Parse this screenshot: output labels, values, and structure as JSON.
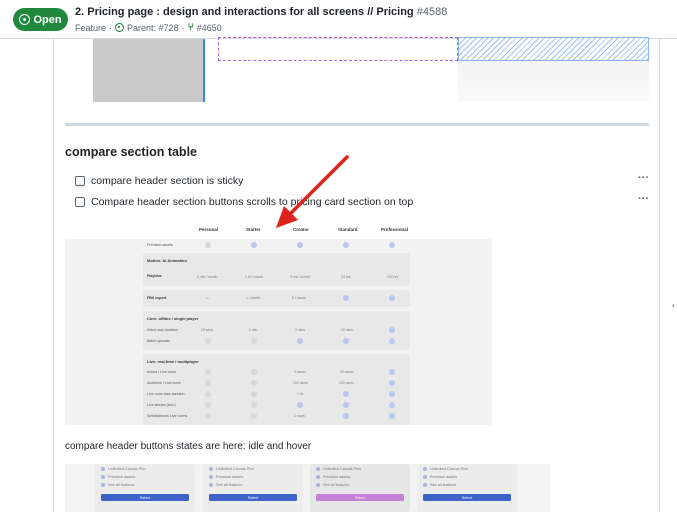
{
  "header": {
    "status_label": "Open",
    "title": "2. Pricing page : design and interactions for all screens // Pricing",
    "number": "#4588",
    "type": "Feature",
    "parent": "Parent: #728",
    "linked_pr": "#4650"
  },
  "section": {
    "heading": "compare section table",
    "tasks": [
      {
        "label": "compare header section is sticky",
        "checked": false
      },
      {
        "label": "Compare header section buttons scrolls to pricing card section on top",
        "checked": false
      }
    ],
    "more_label": "···",
    "caption": "compare header buttons states are here: idle and hover"
  },
  "compare_shot": {
    "columns": [
      "Personal",
      "Starter",
      "Creator",
      "Standard",
      "Professional"
    ],
    "sections": [
      "Motion: AI Animation",
      "Core: offline / single player",
      "Live: real-time / multiplayer"
    ],
    "rows": [
      "Premium assets",
      "Playtime",
      "FBX export",
      "Video max duration",
      "Batch uploads",
      "Actors / Live room",
      "Audience / Live room",
      "Live room max duration",
      "Live stream (sec.)",
      "Simultaneous Live rooms"
    ],
    "values": {
      "playtime": [
        "5 min / month",
        "1 hr / month",
        "3 hrs / month",
        "24 hrs",
        "100 hrs"
      ],
      "fbx": [
        "—",
        "1 / month",
        "5 / month"
      ],
      "video": [
        "20 secs",
        "1 min",
        "3 mins",
        "10 mins"
      ],
      "actors": [
        "3 actors",
        "10 actors"
      ],
      "audience": [
        "100 users",
        "100 users"
      ],
      "duration": [
        "1 hr"
      ],
      "simul": [
        "1 room"
      ]
    }
  },
  "buttons_shot": {
    "rows": [
      "Unlimited Canvas Plus",
      "Premium assets",
      "See all features"
    ],
    "button_label": "Select",
    "colors": {
      "idle": "#3d63c9",
      "hover": "#c47fd6"
    }
  },
  "colors": {
    "open_badge": "#1f883d",
    "annotation_arrow": "#e0221c"
  }
}
